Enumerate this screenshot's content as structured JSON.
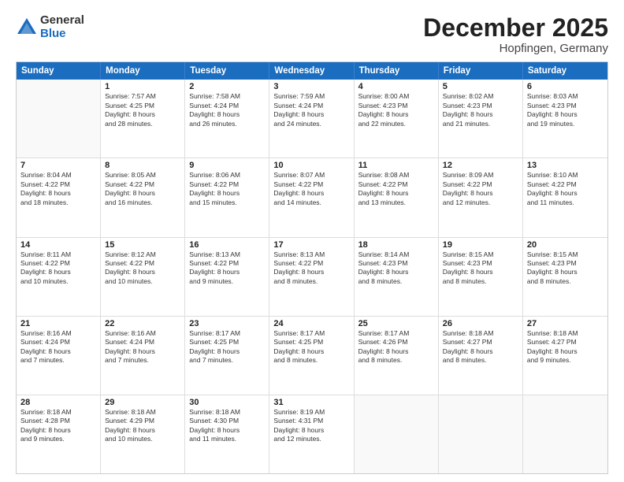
{
  "logo": {
    "general": "General",
    "blue": "Blue"
  },
  "title": "December 2025",
  "location": "Hopfingen, Germany",
  "header": {
    "days": [
      "Sunday",
      "Monday",
      "Tuesday",
      "Wednesday",
      "Thursday",
      "Friday",
      "Saturday"
    ]
  },
  "weeks": [
    [
      {
        "day": "",
        "info": ""
      },
      {
        "day": "1",
        "info": "Sunrise: 7:57 AM\nSunset: 4:25 PM\nDaylight: 8 hours\nand 28 minutes."
      },
      {
        "day": "2",
        "info": "Sunrise: 7:58 AM\nSunset: 4:24 PM\nDaylight: 8 hours\nand 26 minutes."
      },
      {
        "day": "3",
        "info": "Sunrise: 7:59 AM\nSunset: 4:24 PM\nDaylight: 8 hours\nand 24 minutes."
      },
      {
        "day": "4",
        "info": "Sunrise: 8:00 AM\nSunset: 4:23 PM\nDaylight: 8 hours\nand 22 minutes."
      },
      {
        "day": "5",
        "info": "Sunrise: 8:02 AM\nSunset: 4:23 PM\nDaylight: 8 hours\nand 21 minutes."
      },
      {
        "day": "6",
        "info": "Sunrise: 8:03 AM\nSunset: 4:23 PM\nDaylight: 8 hours\nand 19 minutes."
      }
    ],
    [
      {
        "day": "7",
        "info": "Sunrise: 8:04 AM\nSunset: 4:22 PM\nDaylight: 8 hours\nand 18 minutes."
      },
      {
        "day": "8",
        "info": "Sunrise: 8:05 AM\nSunset: 4:22 PM\nDaylight: 8 hours\nand 16 minutes."
      },
      {
        "day": "9",
        "info": "Sunrise: 8:06 AM\nSunset: 4:22 PM\nDaylight: 8 hours\nand 15 minutes."
      },
      {
        "day": "10",
        "info": "Sunrise: 8:07 AM\nSunset: 4:22 PM\nDaylight: 8 hours\nand 14 minutes."
      },
      {
        "day": "11",
        "info": "Sunrise: 8:08 AM\nSunset: 4:22 PM\nDaylight: 8 hours\nand 13 minutes."
      },
      {
        "day": "12",
        "info": "Sunrise: 8:09 AM\nSunset: 4:22 PM\nDaylight: 8 hours\nand 12 minutes."
      },
      {
        "day": "13",
        "info": "Sunrise: 8:10 AM\nSunset: 4:22 PM\nDaylight: 8 hours\nand 11 minutes."
      }
    ],
    [
      {
        "day": "14",
        "info": "Sunrise: 8:11 AM\nSunset: 4:22 PM\nDaylight: 8 hours\nand 10 minutes."
      },
      {
        "day": "15",
        "info": "Sunrise: 8:12 AM\nSunset: 4:22 PM\nDaylight: 8 hours\nand 10 minutes."
      },
      {
        "day": "16",
        "info": "Sunrise: 8:13 AM\nSunset: 4:22 PM\nDaylight: 8 hours\nand 9 minutes."
      },
      {
        "day": "17",
        "info": "Sunrise: 8:13 AM\nSunset: 4:22 PM\nDaylight: 8 hours\nand 8 minutes."
      },
      {
        "day": "18",
        "info": "Sunrise: 8:14 AM\nSunset: 4:23 PM\nDaylight: 8 hours\nand 8 minutes."
      },
      {
        "day": "19",
        "info": "Sunrise: 8:15 AM\nSunset: 4:23 PM\nDaylight: 8 hours\nand 8 minutes."
      },
      {
        "day": "20",
        "info": "Sunrise: 8:15 AM\nSunset: 4:23 PM\nDaylight: 8 hours\nand 8 minutes."
      }
    ],
    [
      {
        "day": "21",
        "info": "Sunrise: 8:16 AM\nSunset: 4:24 PM\nDaylight: 8 hours\nand 7 minutes."
      },
      {
        "day": "22",
        "info": "Sunrise: 8:16 AM\nSunset: 4:24 PM\nDaylight: 8 hours\nand 7 minutes."
      },
      {
        "day": "23",
        "info": "Sunrise: 8:17 AM\nSunset: 4:25 PM\nDaylight: 8 hours\nand 7 minutes."
      },
      {
        "day": "24",
        "info": "Sunrise: 8:17 AM\nSunset: 4:25 PM\nDaylight: 8 hours\nand 8 minutes."
      },
      {
        "day": "25",
        "info": "Sunrise: 8:17 AM\nSunset: 4:26 PM\nDaylight: 8 hours\nand 8 minutes."
      },
      {
        "day": "26",
        "info": "Sunrise: 8:18 AM\nSunset: 4:27 PM\nDaylight: 8 hours\nand 8 minutes."
      },
      {
        "day": "27",
        "info": "Sunrise: 8:18 AM\nSunset: 4:27 PM\nDaylight: 8 hours\nand 9 minutes."
      }
    ],
    [
      {
        "day": "28",
        "info": "Sunrise: 8:18 AM\nSunset: 4:28 PM\nDaylight: 8 hours\nand 9 minutes."
      },
      {
        "day": "29",
        "info": "Sunrise: 8:18 AM\nSunset: 4:29 PM\nDaylight: 8 hours\nand 10 minutes."
      },
      {
        "day": "30",
        "info": "Sunrise: 8:18 AM\nSunset: 4:30 PM\nDaylight: 8 hours\nand 11 minutes."
      },
      {
        "day": "31",
        "info": "Sunrise: 8:19 AM\nSunset: 4:31 PM\nDaylight: 8 hours\nand 12 minutes."
      },
      {
        "day": "",
        "info": ""
      },
      {
        "day": "",
        "info": ""
      },
      {
        "day": "",
        "info": ""
      }
    ]
  ]
}
